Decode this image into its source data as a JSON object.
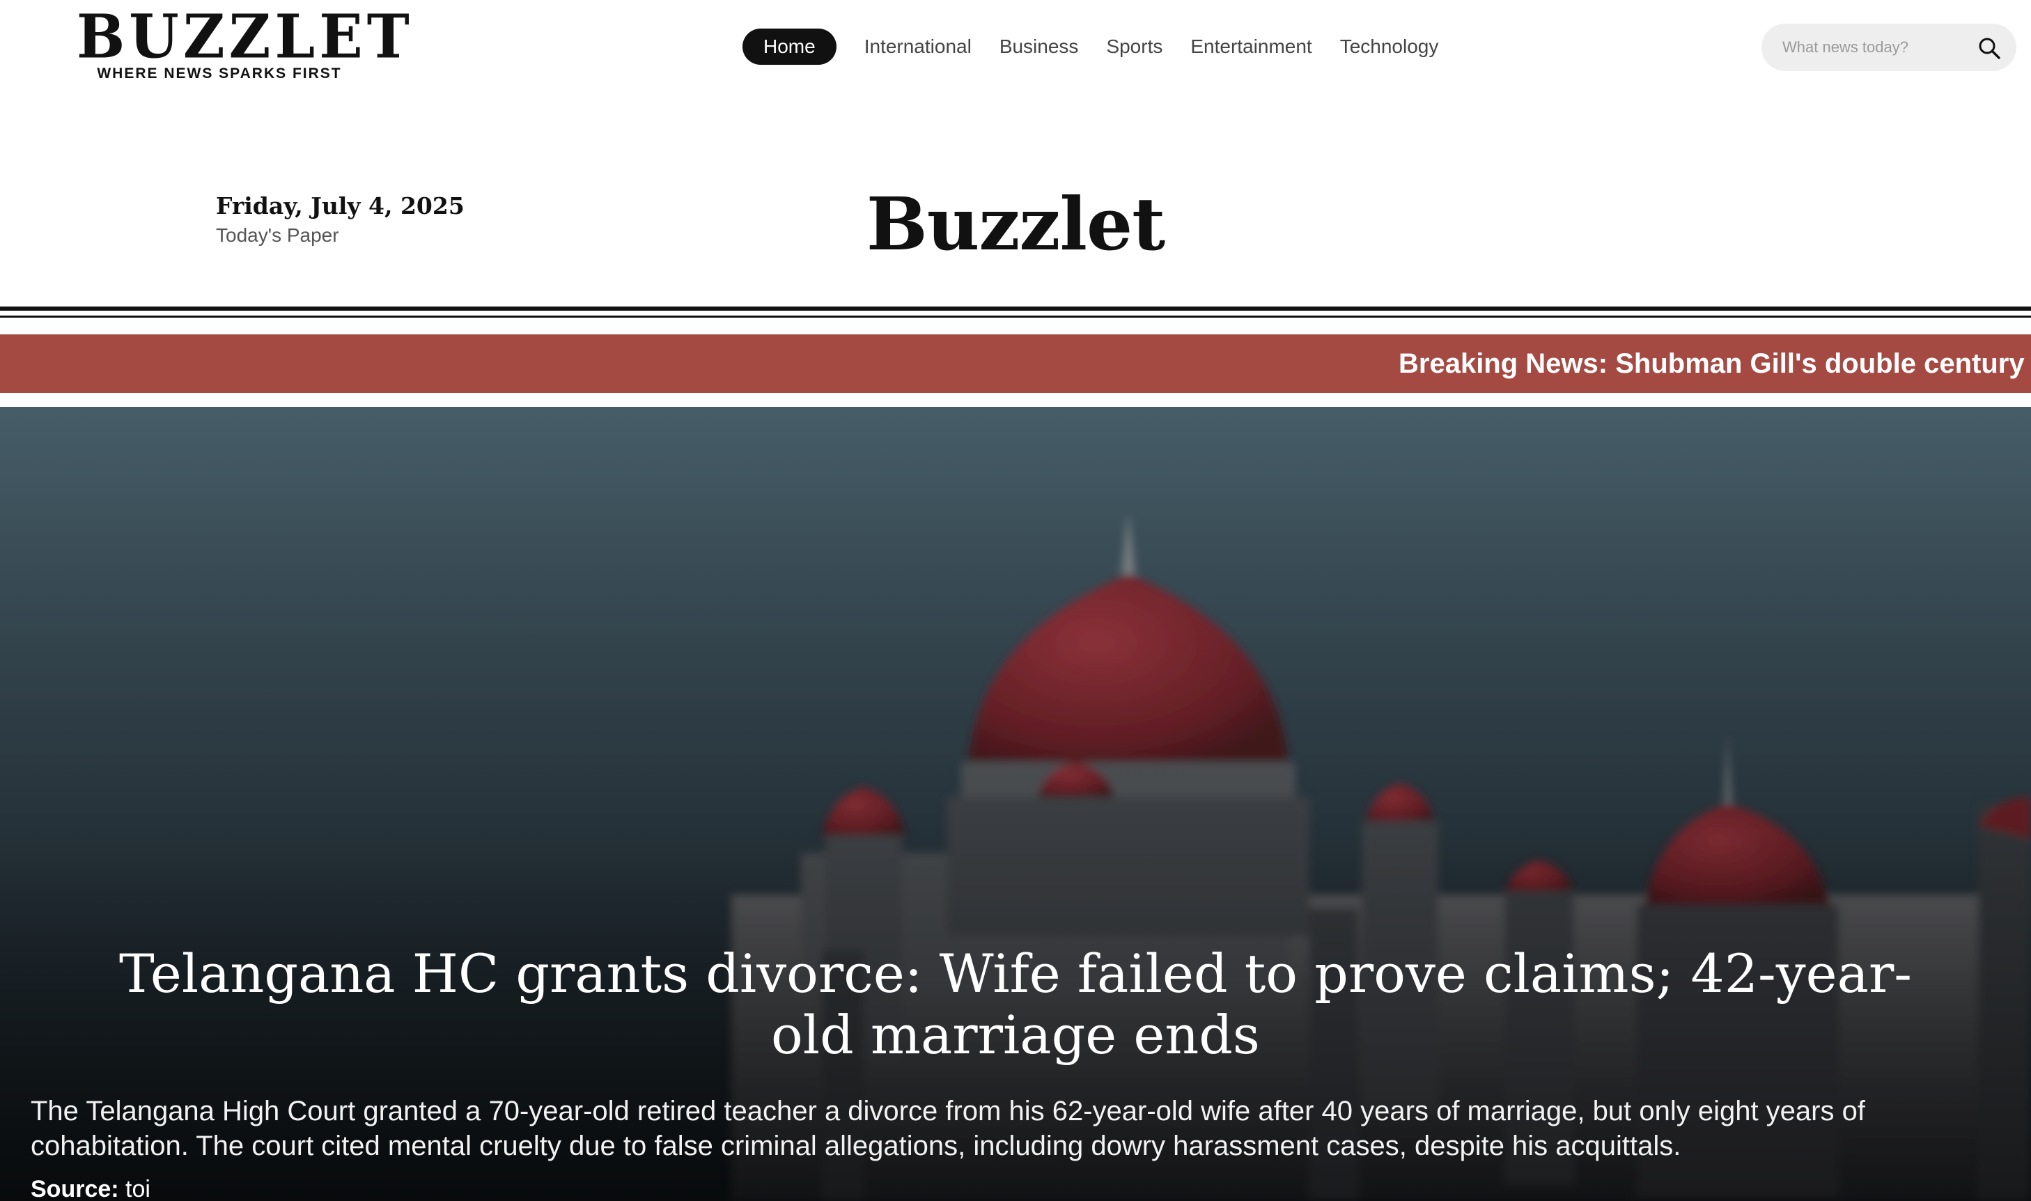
{
  "brand": {
    "logo_word": "BUZZLET",
    "logo_tagline": "WHERE NEWS SPARKS FIRST"
  },
  "nav": {
    "items": [
      {
        "label": "Home",
        "active": true
      },
      {
        "label": "International",
        "active": false
      },
      {
        "label": "Business",
        "active": false
      },
      {
        "label": "Sports",
        "active": false
      },
      {
        "label": "Entertainment",
        "active": false
      },
      {
        "label": "Technology",
        "active": false
      }
    ]
  },
  "search": {
    "placeholder": "What news today?",
    "value": "",
    "icon": "search-icon"
  },
  "masthead": {
    "date": "Friday, July 4, 2025",
    "todays_paper": "Today's Paper",
    "title": "Buzzlet"
  },
  "ticker": {
    "text": "Breaking News: Shubman Gill's double century ig",
    "color": "#a44a43"
  },
  "hero": {
    "headline": "Telangana HC grants divorce: Wife failed to prove claims; 42-year-old marriage ends",
    "summary": "The Telangana High Court granted a 70-year-old retired teacher a divorce from his 62-year-old wife after 40 years of marriage, but only eight years of cohabitation. The court cited mental cruelty due to false criminal allegations, including dowry harassment cases, despite his acquittals.",
    "source_label": "Source:",
    "source_value": "toi"
  },
  "colors": {
    "accent_dark": "#111111",
    "ticker_red": "#a44a43",
    "dome_red": "#8e1f24"
  }
}
